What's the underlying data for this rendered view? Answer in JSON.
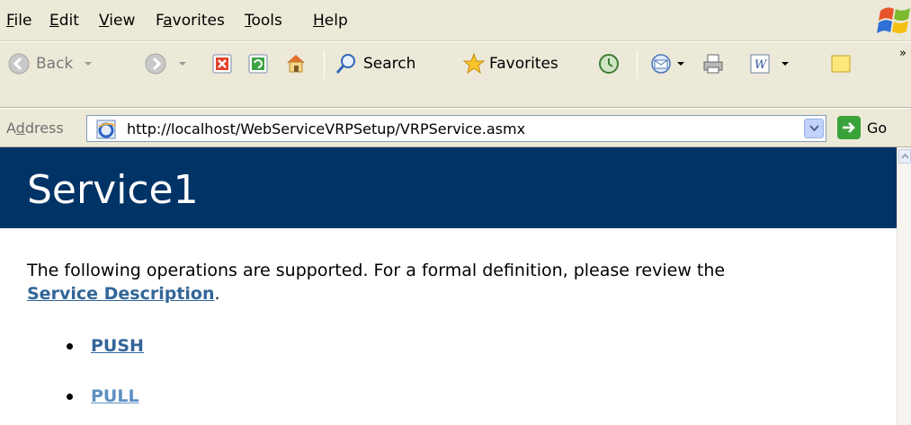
{
  "menubar": {
    "items": [
      {
        "pre": "",
        "u": "F",
        "post": "ile"
      },
      {
        "pre": "",
        "u": "E",
        "post": "dit"
      },
      {
        "pre": "",
        "u": "V",
        "post": "iew"
      },
      {
        "pre": "F",
        "u": "a",
        "post": "vorites"
      },
      {
        "pre": "",
        "u": "T",
        "post": "ools"
      },
      {
        "pre": "",
        "u": "H",
        "post": "elp"
      }
    ]
  },
  "toolbar": {
    "back_label": "Back",
    "search_label": "Search",
    "favorites_label": "Favorites",
    "icons": [
      "back-icon",
      "forward-icon",
      "stop-icon",
      "refresh-icon",
      "home-icon",
      "search-icon",
      "favorites-star-icon",
      "history-icon",
      "mail-icon",
      "print-icon",
      "word-icon",
      "notes-icon"
    ],
    "overflow_glyph": "»"
  },
  "address": {
    "label": "Address",
    "url": "http://localhost/WebServiceVRPSetup/VRPService.asmx",
    "go_label": "Go"
  },
  "page": {
    "title": "Service1",
    "intro_text": "The following operations are supported. For a formal definition, please review the",
    "service_description_link": "Service Description",
    "intro_suffix": ".",
    "operations": [
      "PUSH",
      "PULL"
    ]
  },
  "colors": {
    "header_band": "#003366",
    "link": "#336699",
    "chrome": "#ece9d8"
  }
}
